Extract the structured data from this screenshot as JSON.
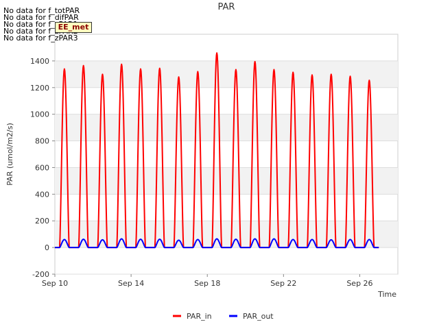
{
  "no_data_messages": [
    "No data for f_totPAR",
    "No data for f_difPAR",
    "No data for f_zPAR1",
    "No data for f_zPAR2",
    "No data for f_zPAR3"
  ],
  "site_tag": "EE_met",
  "chart_data": {
    "type": "line",
    "title": "PAR",
    "xlabel": "Time",
    "ylabel": "PAR (umol/m2/s)",
    "xlim": [
      "2023-09-10",
      "2023-09-28"
    ],
    "ylim": [
      -200,
      1600
    ],
    "yticks": [
      -200,
      0,
      200,
      400,
      600,
      800,
      1000,
      1200,
      1400
    ],
    "xticks": [
      "Sep 10",
      "Sep 14",
      "Sep 18",
      "Sep 22",
      "Sep 26"
    ],
    "xtick_dates": [
      "2023-09-10",
      "2023-09-14",
      "2023-09-18",
      "2023-09-22",
      "2023-09-26"
    ],
    "legend": "bottom-center",
    "grid": true,
    "background_bands": true,
    "series": [
      {
        "name": "PAR_in",
        "color": "#ff0000",
        "daily_peaks": [
          {
            "date": "2023-09-10",
            "peak": 1340
          },
          {
            "date": "2023-09-11",
            "peak": 1365
          },
          {
            "date": "2023-09-12",
            "peak": 1300
          },
          {
            "date": "2023-09-13",
            "peak": 1375
          },
          {
            "date": "2023-09-14",
            "peak": 1340
          },
          {
            "date": "2023-09-15",
            "peak": 1345
          },
          {
            "date": "2023-09-16",
            "peak": 1280
          },
          {
            "date": "2023-09-17",
            "peak": 1320
          },
          {
            "date": "2023-09-18",
            "peak": 1460
          },
          {
            "date": "2023-09-19",
            "peak": 1335
          },
          {
            "date": "2023-09-20",
            "peak": 1395
          },
          {
            "date": "2023-09-21",
            "peak": 1335
          },
          {
            "date": "2023-09-22",
            "peak": 1315
          },
          {
            "date": "2023-09-23",
            "peak": 1295
          },
          {
            "date": "2023-09-24",
            "peak": 1300
          },
          {
            "date": "2023-09-25",
            "peak": 1285
          },
          {
            "date": "2023-09-26",
            "peak": 1255
          }
        ]
      },
      {
        "name": "PAR_out",
        "color": "#0000ff",
        "daily_peaks": [
          {
            "date": "2023-09-10",
            "peak": 60
          },
          {
            "date": "2023-09-11",
            "peak": 62
          },
          {
            "date": "2023-09-12",
            "peak": 58
          },
          {
            "date": "2023-09-13",
            "peak": 65
          },
          {
            "date": "2023-09-14",
            "peak": 62
          },
          {
            "date": "2023-09-15",
            "peak": 62
          },
          {
            "date": "2023-09-16",
            "peak": 55
          },
          {
            "date": "2023-09-17",
            "peak": 60
          },
          {
            "date": "2023-09-18",
            "peak": 65
          },
          {
            "date": "2023-09-19",
            "peak": 62
          },
          {
            "date": "2023-09-20",
            "peak": 65
          },
          {
            "date": "2023-09-21",
            "peak": 65
          },
          {
            "date": "2023-09-22",
            "peak": 60
          },
          {
            "date": "2023-09-23",
            "peak": 60
          },
          {
            "date": "2023-09-24",
            "peak": 58
          },
          {
            "date": "2023-09-25",
            "peak": 60
          },
          {
            "date": "2023-09-26",
            "peak": 60
          }
        ]
      }
    ]
  }
}
